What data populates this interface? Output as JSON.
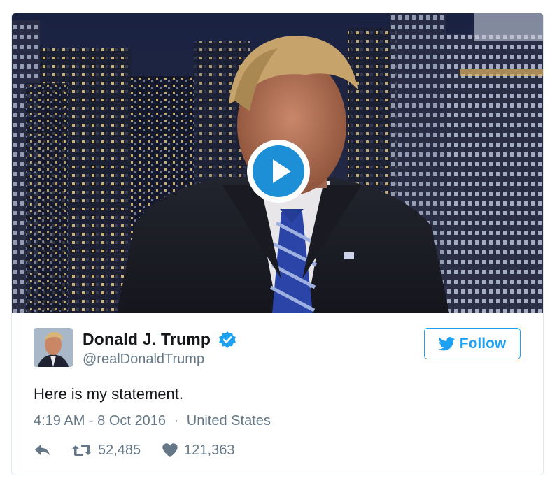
{
  "tweet": {
    "display_name": "Donald J. Trump",
    "handle": "@realDonaldTrump",
    "verified": true,
    "follow_label": "Follow",
    "text": "Here is my statement.",
    "timestamp": "4:19 AM - 8 Oct 2016",
    "separator": "·",
    "location": "United States",
    "retweet_count": "52,485",
    "like_count": "121,363"
  },
  "colors": {
    "accent": "#1da1f2",
    "text": "#14171a",
    "muted": "#657786",
    "border": "#e1e8ed",
    "play_button": "#1c8fd6"
  },
  "icons": {
    "play": "play-icon",
    "verified": "verified-badge-icon",
    "follow": "twitter-bird-icon",
    "reply": "reply-icon",
    "retweet": "retweet-icon",
    "like": "heart-icon"
  }
}
